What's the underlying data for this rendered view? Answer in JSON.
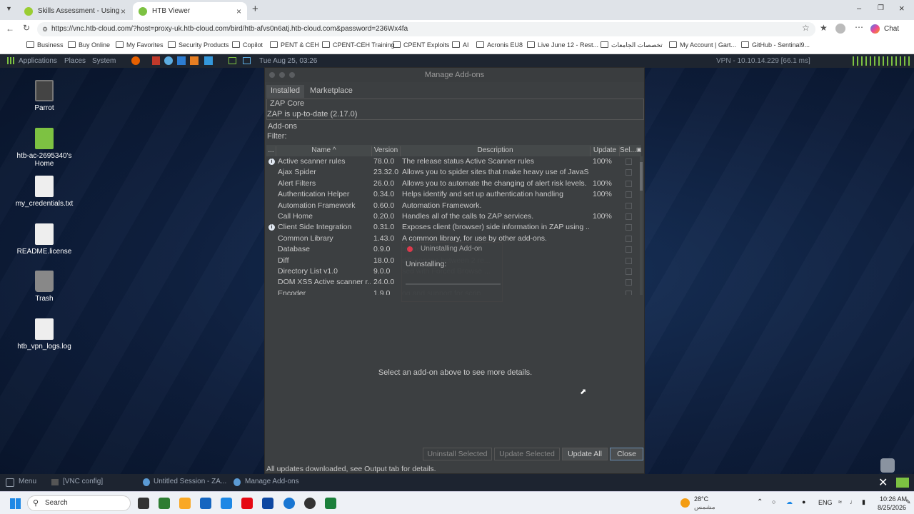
{
  "browser": {
    "tabs": [
      {
        "title": "Skills Assessment - Using Web Pro"
      },
      {
        "title": "HTB Viewer"
      }
    ],
    "new_tab": "+",
    "url": "https://vnc.htb-cloud.com/?host=proxy-uk.htb-cloud.com/bird/htb-afvs0n6atj.htb-cloud.com&password=236Wx4fa",
    "chat_label": "Chat",
    "bookmarks": [
      "Business",
      "Buy Online",
      "My Favorites",
      "Security Products",
      "Copilot",
      "PENT & CEH",
      "CPENT-CEH Training",
      "CPENT Exploits",
      "AI",
      "Acronis EU8",
      "Live June 12 - Rest...",
      "تخصصات الجامعات",
      "My Account | Gart...",
      "GitHub - Sentinal9..."
    ]
  },
  "remote_panel": {
    "menus": [
      "Applications",
      "Places",
      "System"
    ],
    "datetime": "Tue Aug 25, 03:26",
    "vpn": "VPN - 10.10.14.229 [66.1 ms]"
  },
  "desktop_icons": [
    {
      "label": "Parrot"
    },
    {
      "label": "htb-ac-2695340's Home"
    },
    {
      "label": "my_credentials.txt"
    },
    {
      "label": "README.license"
    },
    {
      "label": "Trash"
    },
    {
      "label": "htb_vpn_logs.log"
    }
  ],
  "zap": {
    "title": "Manage Add-ons",
    "tabs": [
      "Installed",
      "Marketplace"
    ],
    "core_label": "ZAP Core",
    "core_status": "ZAP is up-to-date (2.17.0)",
    "addons_label": "Add-ons",
    "filter_label": "Filter:",
    "columns": [
      "...",
      "Name ^",
      "Version",
      "Description",
      "Update",
      "Sel..."
    ],
    "rows": [
      {
        "info": true,
        "name": "Active scanner rules",
        "version": "78.0.0",
        "desc": "The release status Active Scanner rules",
        "update": "100%"
      },
      {
        "info": false,
        "name": "Ajax Spider",
        "version": "23.32.0",
        "desc": "Allows you to spider sites that make heavy use of JavaS...",
        "update": ""
      },
      {
        "info": false,
        "name": "Alert Filters",
        "version": "26.0.0",
        "desc": "Allows you to automate the changing of alert risk levels.",
        "update": "100%"
      },
      {
        "info": false,
        "name": "Authentication Helper",
        "version": "0.34.0",
        "desc": "Helps identify and set up authentication handling",
        "update": "100%"
      },
      {
        "info": false,
        "name": "Automation Framework",
        "version": "0.60.0",
        "desc": "Automation Framework.",
        "update": ""
      },
      {
        "info": false,
        "name": "Call Home",
        "version": "0.20.0",
        "desc": "Handles all of the calls to ZAP services.",
        "update": "100%"
      },
      {
        "info": true,
        "name": "Client Side Integration",
        "version": "0.31.0",
        "desc": "Exposes client (browser) side information in ZAP using ...",
        "update": ""
      },
      {
        "info": false,
        "name": "Common Library",
        "version": "1.43.0",
        "desc": "A common library, for use by other add-ons.",
        "update": ""
      },
      {
        "info": false,
        "name": "Database",
        "version": "0.9.0",
        "desc": "related infrastructure.",
        "update": ""
      },
      {
        "info": false,
        "name": "Diff",
        "version": "18.0.0",
        "desc": "differences between 2 re...",
        "update": ""
      },
      {
        "info": false,
        "name": "Directory List v1.0",
        "version": "9.0.0",
        "desc": "sed with Forced Browse ...",
        "update": ""
      },
      {
        "info": false,
        "name": "DOM XSS Active scanner r...",
        "version": "24.0.0",
        "desc": "",
        "update": ""
      },
      {
        "info": false,
        "name": "Encoder",
        "version": "1.9.0",
        "desc": "og and support for scrip...",
        "update": ""
      }
    ],
    "details_message": "Select an add-on above to see more details.",
    "buttons": {
      "uninstall": "Uninstall Selected",
      "update_selected": "Update Selected",
      "update_all": "Update All",
      "close": "Close"
    },
    "status": "All updates downloaded, see Output tab for details.",
    "progress_title": "Uninstalling Add-on",
    "progress_label": "Uninstalling:"
  },
  "remote_taskbar": {
    "menu": "Menu",
    "items": [
      "[VNC config]",
      "Untitled Session - ZA...",
      "Manage Add-ons"
    ]
  },
  "windows_taskbar": {
    "search_placeholder": "Search",
    "weather_temp": "28°C",
    "weather_desc": "مشمس",
    "lang": "ENG",
    "time": "10:26 AM",
    "date": "8/25/2026"
  }
}
